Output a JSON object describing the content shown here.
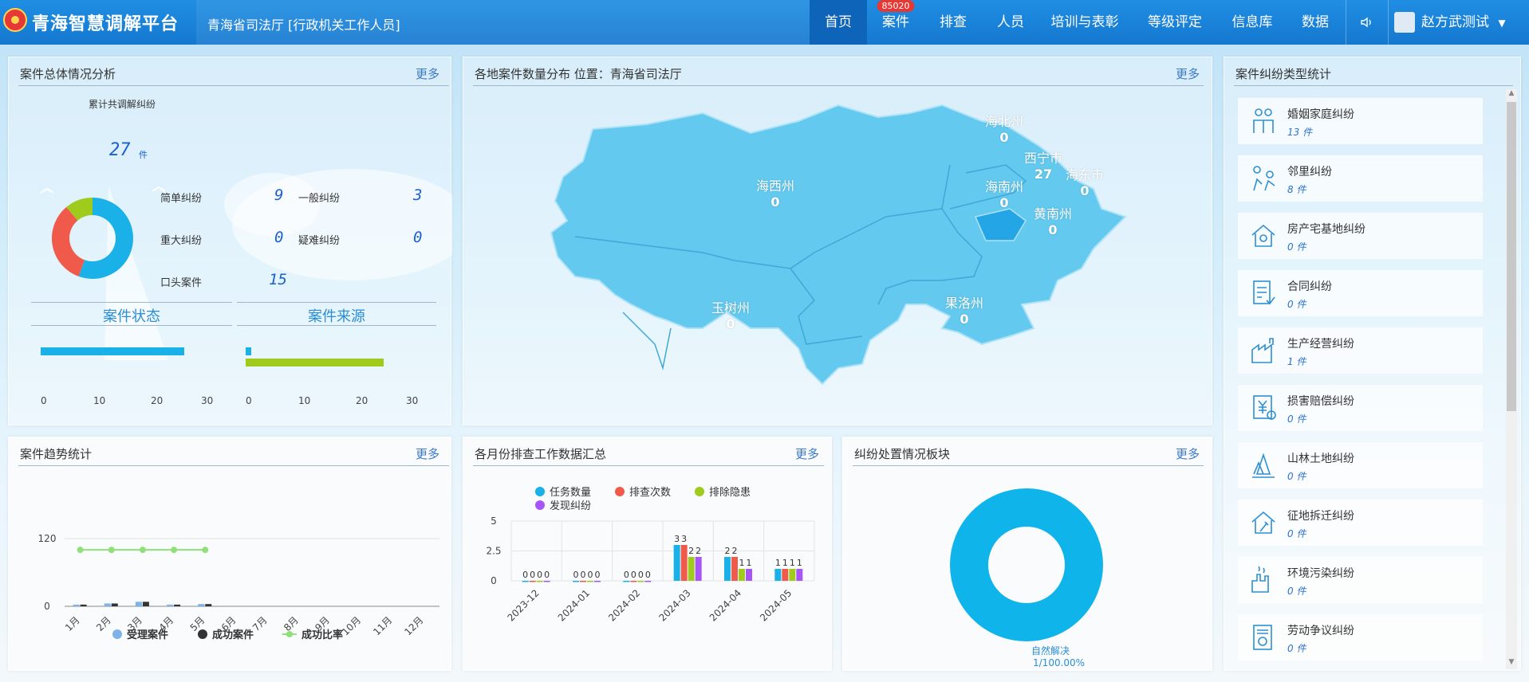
{
  "header": {
    "app_title": "青海智慧调解平台",
    "org": "青海省司法厅 [行政机关工作人员]",
    "nav": [
      {
        "label": "首页"
      },
      {
        "label": "案件",
        "badge": "85020"
      },
      {
        "label": "排查"
      },
      {
        "label": "人员"
      },
      {
        "label": "培训与表彰"
      },
      {
        "label": "等级评定"
      },
      {
        "label": "信息库"
      },
      {
        "label": "数据"
      }
    ],
    "user": "赵方武测试"
  },
  "more": "更多",
  "overview": {
    "title": "案件总体情况分析",
    "cumulative_label": "累计共调解纠纷",
    "total": "27",
    "unit": "件",
    "items": [
      {
        "label": "简单纠纷",
        "value": "9"
      },
      {
        "label": "一般纠纷",
        "value": "3"
      },
      {
        "label": "重大纠纷",
        "value": "0"
      },
      {
        "label": "疑难纠纷",
        "value": "0"
      },
      {
        "label": "口头案件",
        "value": "15"
      }
    ],
    "donut": [
      {
        "value": 15,
        "color": "#1ab0e8"
      },
      {
        "value": 9,
        "color": "#ef5a4b"
      },
      {
        "value": 3,
        "color": "#9fcb1c"
      }
    ],
    "status_label": "案件状态",
    "source_label": "案件来源",
    "status_bar": {
      "value": 27,
      "max": 30,
      "color": "#1ab0e8"
    },
    "source_bars": [
      {
        "value": 1,
        "max": 30,
        "color": "#1ab0e8"
      },
      {
        "value": 26,
        "max": 30,
        "color": "#9fcb1c"
      }
    ],
    "ticks": [
      "0",
      "10",
      "20",
      "30"
    ]
  },
  "map": {
    "title": "各地案件数量分布 位置：青海省司法厅",
    "regions": [
      {
        "name": "海北州",
        "value": "0"
      },
      {
        "name": "西宁市",
        "value": "27"
      },
      {
        "name": "海东市",
        "value": "0"
      },
      {
        "name": "海西州",
        "value": "0"
      },
      {
        "name": "海南州",
        "value": "0"
      },
      {
        "name": "黄南州",
        "value": "0"
      },
      {
        "name": "玉树州",
        "value": "0"
      },
      {
        "name": "果洛州",
        "value": "0"
      }
    ]
  },
  "types": {
    "title": "案件纠纷类型统计",
    "items": [
      {
        "name": "婚姻家庭纠纷",
        "count": "13 件",
        "icon": "family-icon"
      },
      {
        "name": "邻里纠纷",
        "count": "8 件",
        "icon": "neighbor-icon"
      },
      {
        "name": "房产宅基地纠纷",
        "count": "0 件",
        "icon": "house-icon"
      },
      {
        "name": "合同纠纷",
        "count": "0 件",
        "icon": "contract-icon"
      },
      {
        "name": "生产经营纠纷",
        "count": "1 件",
        "icon": "factory-icon"
      },
      {
        "name": "损害赔偿纠纷",
        "count": "0 件",
        "icon": "compensation-icon"
      },
      {
        "name": "山林土地纠纷",
        "count": "0 件",
        "icon": "forest-icon"
      },
      {
        "name": "征地拆迁纠纷",
        "count": "0 件",
        "icon": "demolition-icon"
      },
      {
        "name": "环境污染纠纷",
        "count": "0 件",
        "icon": "pollution-icon"
      },
      {
        "name": "劳动争议纠纷",
        "count": "0 件",
        "icon": "labor-icon"
      }
    ]
  },
  "trend": {
    "title": "案件趋势统计",
    "legend": [
      "受理案件",
      "成功案件",
      "成功比率"
    ],
    "colors": [
      "#7fb2ea",
      "#333333",
      "#90e07a"
    ],
    "chart_data": {
      "type": "bar+line",
      "categories": [
        "1月",
        "2月",
        "3月",
        "4月",
        "5月",
        "6月",
        "7月",
        "8月",
        "9月",
        "10月",
        "11月",
        "12月"
      ],
      "yticks": [
        "120",
        "0"
      ],
      "ylim": [
        0,
        120
      ],
      "series": [
        {
          "name": "受理案件",
          "values": [
            3,
            5,
            8,
            3,
            4,
            0,
            0,
            0,
            0,
            0,
            0,
            0
          ]
        },
        {
          "name": "成功案件",
          "values": [
            3,
            5,
            8,
            3,
            4,
            0,
            0,
            0,
            0,
            0,
            0,
            0
          ]
        },
        {
          "name": "成功比率",
          "values": [
            100,
            100,
            100,
            100,
            100,
            null,
            null,
            null,
            null,
            null,
            null,
            null
          ]
        }
      ]
    }
  },
  "survey": {
    "title": "各月份排查工作数据汇总",
    "legend": [
      "任务数量",
      "排查次数",
      "排除隐患",
      "发现纠纷"
    ],
    "colors": [
      "#1ab0e8",
      "#ef5a4b",
      "#9fcb1c",
      "#a855f7"
    ],
    "chart_data": {
      "type": "bar",
      "categories": [
        "2023-12",
        "2024-01",
        "2024-02",
        "2024-03",
        "2024-04",
        "2024-05"
      ],
      "yticks": [
        "5",
        "2.5",
        "0"
      ],
      "ylim": [
        0,
        5
      ],
      "series": [
        {
          "name": "任务数量",
          "values": [
            0,
            0,
            0,
            3,
            2,
            1
          ]
        },
        {
          "name": "排查次数",
          "values": [
            0,
            0,
            0,
            3,
            2,
            1
          ]
        },
        {
          "name": "排除隐患",
          "values": [
            0,
            0,
            0,
            2,
            1,
            1
          ]
        },
        {
          "name": "发现纠纷",
          "values": [
            0,
            0,
            0,
            2,
            1,
            1
          ]
        }
      ]
    }
  },
  "disposal": {
    "title": "纠纷处置情况板块",
    "label": "自然解决",
    "sublabel": "1/100.00%",
    "chart_data": {
      "type": "pie",
      "slices": [
        {
          "label": "自然解决",
          "value": 100
        }
      ],
      "color": "#0fb4ea"
    }
  }
}
